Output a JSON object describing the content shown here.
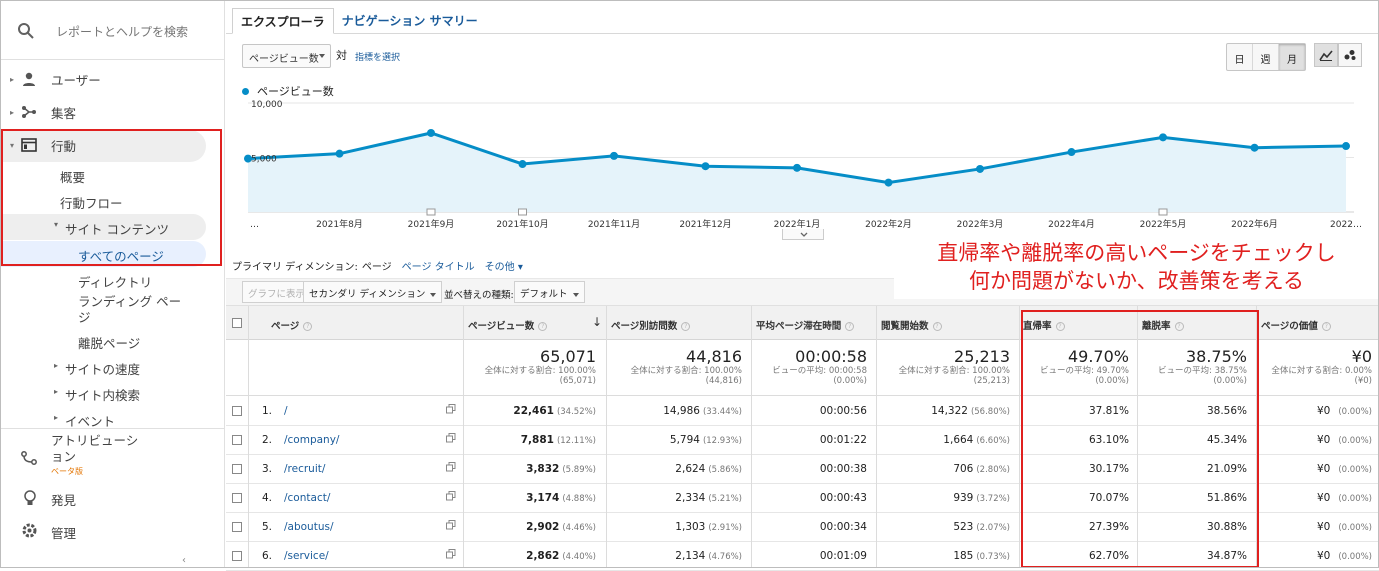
{
  "sidebar": {
    "search_placeholder": "レポートとヘルプを検索",
    "items": [
      {
        "label": "ユーザー",
        "icon": "person-icon"
      },
      {
        "label": "集客",
        "icon": "acquisition-icon"
      },
      {
        "label": "行動",
        "icon": "behavior-icon"
      }
    ],
    "behavior_sub": [
      "概要",
      "行動フロー",
      "サイト コンテンツ",
      "すべてのページ",
      "ディレクトリ",
      "ランディング ページ",
      "離脱ページ",
      "サイトの速度",
      "サイト内検索",
      "イベント"
    ],
    "attribution_label": "アトリビューション",
    "beta_label": "ベータ版",
    "discover_label": "発見",
    "admin_label": "管理"
  },
  "tabs": {
    "explorer": "エクスプローラ",
    "nav_summary": "ナビゲーション サマリー"
  },
  "metric": {
    "selected": "ページビュー数",
    "vs": "対",
    "pick": "指標を選択"
  },
  "period_buttons": {
    "day": "日",
    "week": "週",
    "month": "月",
    "selected": "月"
  },
  "legend_label": "ページビュー数",
  "chart_data": {
    "type": "line",
    "x": [
      "…",
      "2021年8月",
      "2021年9月",
      "2021年10月",
      "2021年11月",
      "2021年12月",
      "2022年1月",
      "2022年2月",
      "2022年3月",
      "2022年4月",
      "2022年5月",
      "2022年6月",
      "2022…"
    ],
    "series": [
      {
        "name": "ページビュー数",
        "values": [
          4900,
          5350,
          7250,
          4400,
          5150,
          4200,
          4050,
          2700,
          3950,
          5500,
          6850,
          5900,
          6050
        ]
      }
    ],
    "yticks": [
      "10,000",
      "5,000"
    ],
    "ylim": [
      0,
      10000
    ],
    "color": "#058dc7",
    "fill": "#e5f3fa"
  },
  "dimension_bar": {
    "label": "プライマリ ディメンション:",
    "current": "ページ",
    "alt": "ページ タイトル",
    "other": "その他"
  },
  "controls": {
    "plot": "グラフに表示",
    "secondary": "セカンダリ ディメンション",
    "sort_label": "並べ替えの種類:",
    "sort_value": "デフォルト"
  },
  "callout": {
    "line1": "直帰率や離脱率の高いページをチェックし",
    "line2": "何か問題がないか、改善策を考える"
  },
  "table": {
    "headers": [
      "ページ",
      "ページビュー数",
      "ページ別訪問数",
      "平均ページ滞在時間",
      "閲覧開始数",
      "直帰率",
      "離脱率",
      "ページの価値"
    ],
    "totals": [
      {
        "value": "65,071",
        "sub1": "全体に対する割合: 100.00%",
        "sub2": "(65,071)"
      },
      {
        "value": "44,816",
        "sub1": "全体に対する割合: 100.00%",
        "sub2": "(44,816)"
      },
      {
        "value": "00:00:58",
        "sub1": "ビューの平均: 00:00:58",
        "sub2": "(0.00%)"
      },
      {
        "value": "25,213",
        "sub1": "全体に対する割合: 100.00%",
        "sub2": "(25,213)"
      },
      {
        "value": "49.70%",
        "sub1": "ビューの平均: 49.70%",
        "sub2": "(0.00%)"
      },
      {
        "value": "38.75%",
        "sub1": "ビューの平均: 38.75%",
        "sub2": "(0.00%)"
      },
      {
        "value": "¥0",
        "sub1": "全体に対する割合: 0.00%",
        "sub2": "(¥0)"
      }
    ],
    "rows": [
      {
        "num": "1.",
        "page": "/",
        "pv": "22,461",
        "pv_pct": "(34.52%)",
        "visits": "14,986",
        "visits_pct": "(33.44%)",
        "time": "00:00:56",
        "entr": "14,322",
        "entr_pct": "(56.80%)",
        "bounce": "37.81%",
        "exit": "38.56%",
        "value": "¥0",
        "value_pct": "(0.00%)"
      },
      {
        "num": "2.",
        "page": "/company/",
        "pv": "7,881",
        "pv_pct": "(12.11%)",
        "visits": "5,794",
        "visits_pct": "(12.93%)",
        "time": "00:01:22",
        "entr": "1,664",
        "entr_pct": "(6.60%)",
        "bounce": "63.10%",
        "exit": "45.34%",
        "value": "¥0",
        "value_pct": "(0.00%)"
      },
      {
        "num": "3.",
        "page": "/recruit/",
        "pv": "3,832",
        "pv_pct": "(5.89%)",
        "visits": "2,624",
        "visits_pct": "(5.86%)",
        "time": "00:00:38",
        "entr": "706",
        "entr_pct": "(2.80%)",
        "bounce": "30.17%",
        "exit": "21.09%",
        "value": "¥0",
        "value_pct": "(0.00%)"
      },
      {
        "num": "4.",
        "page": "/contact/",
        "pv": "3,174",
        "pv_pct": "(4.88%)",
        "visits": "2,334",
        "visits_pct": "(5.21%)",
        "time": "00:00:43",
        "entr": "939",
        "entr_pct": "(3.72%)",
        "bounce": "70.07%",
        "exit": "51.86%",
        "value": "¥0",
        "value_pct": "(0.00%)"
      },
      {
        "num": "5.",
        "page": "/aboutus/",
        "pv": "2,902",
        "pv_pct": "(4.46%)",
        "visits": "1,303",
        "visits_pct": "(2.91%)",
        "time": "00:00:34",
        "entr": "523",
        "entr_pct": "(2.07%)",
        "bounce": "27.39%",
        "exit": "30.88%",
        "value": "¥0",
        "value_pct": "(0.00%)"
      },
      {
        "num": "6.",
        "page": "/service/",
        "pv": "2,862",
        "pv_pct": "(4.40%)",
        "visits": "2,134",
        "visits_pct": "(4.76%)",
        "time": "00:01:09",
        "entr": "185",
        "entr_pct": "(0.73%)",
        "bounce": "62.70%",
        "exit": "34.87%",
        "value": "¥0",
        "value_pct": "(0.00%)"
      }
    ]
  }
}
